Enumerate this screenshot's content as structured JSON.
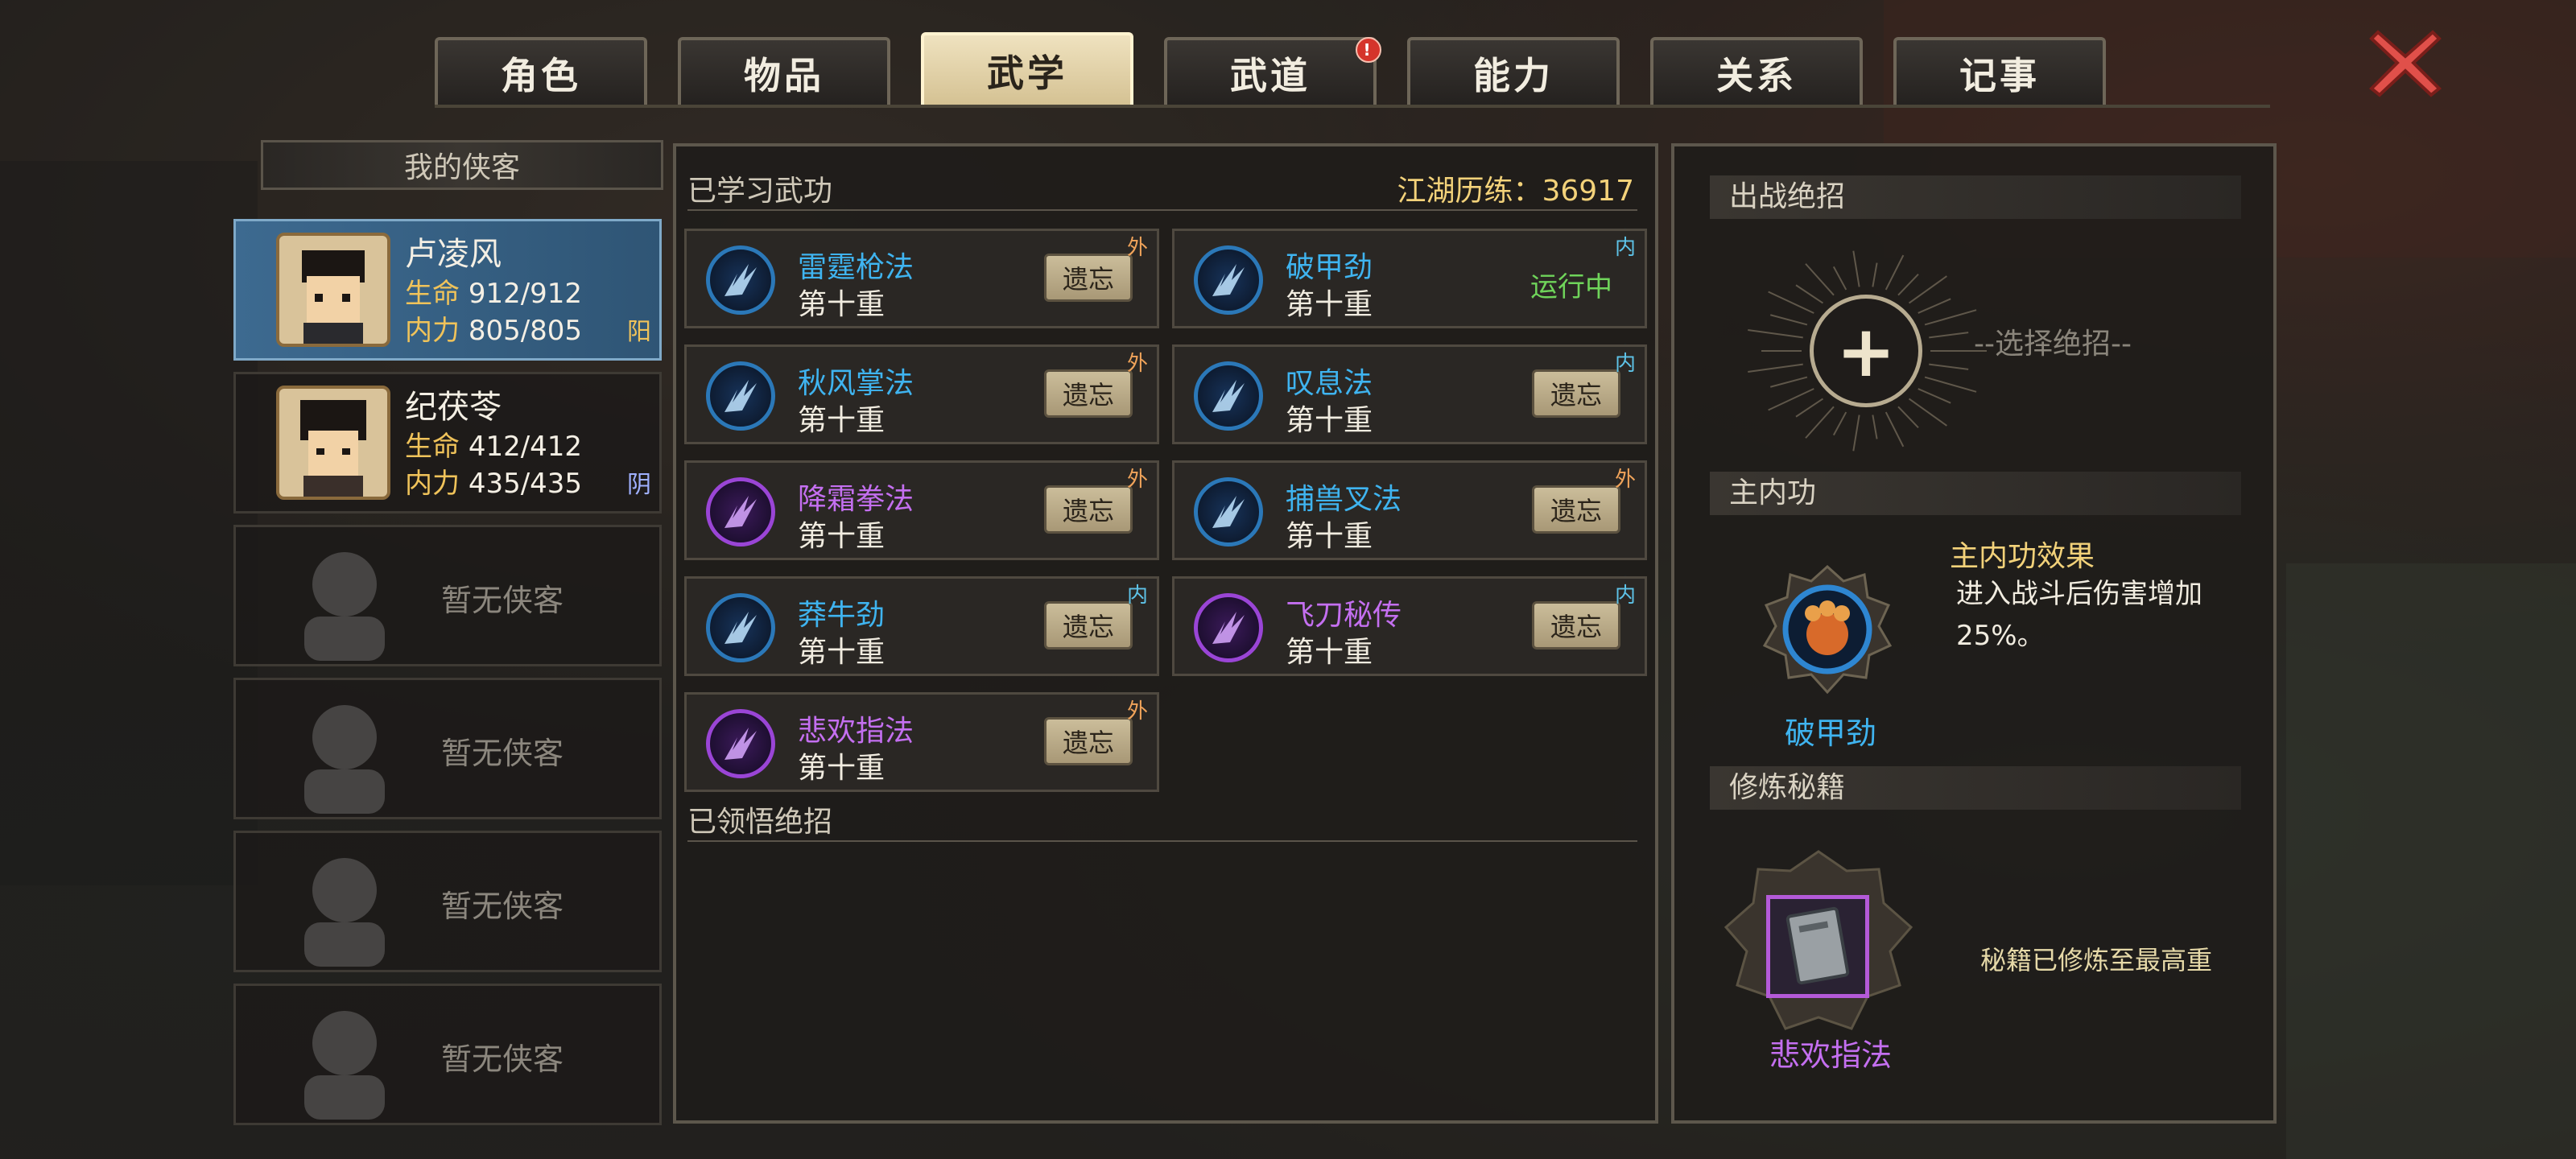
{
  "tabs": [
    {
      "label": "角色"
    },
    {
      "label": "物品"
    },
    {
      "label": "武学"
    },
    {
      "label": "武道"
    },
    {
      "label": "能力"
    },
    {
      "label": "关系"
    },
    {
      "label": "记事"
    }
  ],
  "active_tab": "武学",
  "alert_badge": "!",
  "roster": {
    "title": "我的侠客",
    "heroes": [
      {
        "name": "卢凌风",
        "hp_label": "生命",
        "hp": "912/912",
        "mp_label": "内力",
        "mp": "805/805",
        "align": "阳",
        "selected": true
      },
      {
        "name": "纪茯苓",
        "hp_label": "生命",
        "hp": "412/412",
        "mp_label": "内力",
        "mp": "435/435",
        "align": "阴",
        "selected": false
      }
    ],
    "empty_label": "暂无侠客"
  },
  "learned": {
    "title": "已学习武功",
    "exp_label": "江湖历练：36917",
    "forget_label": "遗忘",
    "running_label": "运行中",
    "skills": [
      {
        "name": "雷霆枪法",
        "level": "第十重",
        "tag": "外",
        "color": "blue",
        "state": "forget"
      },
      {
        "name": "破甲劲",
        "level": "第十重",
        "tag": "内",
        "color": "blue",
        "state": "running"
      },
      {
        "name": "秋风掌法",
        "level": "第十重",
        "tag": "外",
        "color": "blue",
        "state": "forget"
      },
      {
        "name": "叹息法",
        "level": "第十重",
        "tag": "内",
        "color": "blue",
        "state": "forget"
      },
      {
        "name": "降霜拳法",
        "level": "第十重",
        "tag": "外",
        "color": "purple",
        "state": "forget"
      },
      {
        "name": "捕兽叉法",
        "level": "第十重",
        "tag": "外",
        "color": "blue",
        "state": "forget"
      },
      {
        "name": "莽牛劲",
        "level": "第十重",
        "tag": "内",
        "color": "blue",
        "state": "forget"
      },
      {
        "name": "飞刀秘传",
        "level": "第十重",
        "tag": "内",
        "color": "purple",
        "state": "forget"
      },
      {
        "name": "悲欢指法",
        "level": "第十重",
        "tag": "外",
        "color": "purple",
        "state": "forget"
      }
    ]
  },
  "comprehended": {
    "title": "已领悟绝招"
  },
  "right": {
    "battle_title": "出战绝招",
    "plus": "+",
    "choose_label": "--选择绝招--",
    "main_title": "主内功",
    "effect_title": "主内功效果",
    "effect_text": "进入战斗后伤害增加25%。",
    "main_skill": "破甲劲",
    "book_title": "修炼秘籍",
    "book_name": "悲欢指法",
    "book_status": "秘籍已修炼至最高重"
  },
  "colors": {
    "blue": "#3fb4f0",
    "purple": "#c46ff0",
    "gold": "#f0c35a",
    "running": "#6fd45a",
    "close": "#e0504a"
  }
}
